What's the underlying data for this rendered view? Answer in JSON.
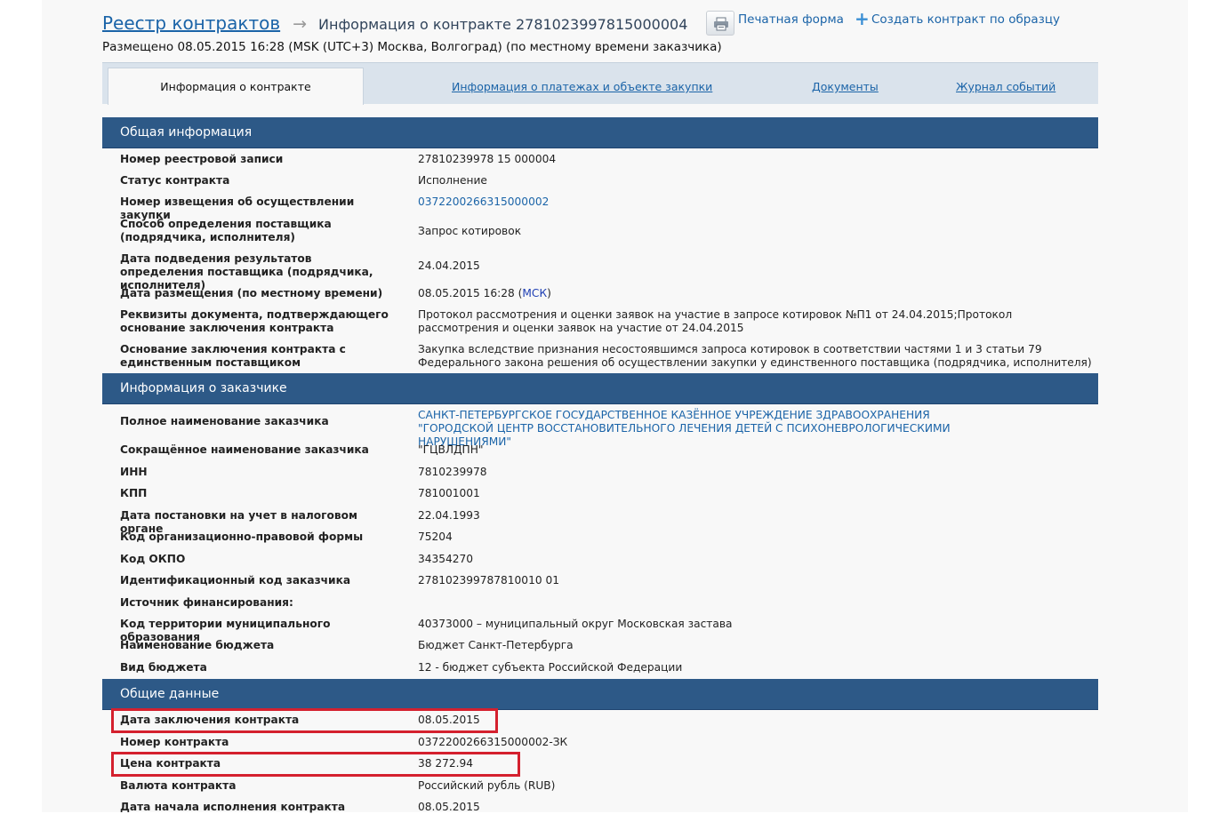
{
  "header": {
    "breadcrumb_link": "Реестр контрактов",
    "breadcrumb_arrow": "→",
    "current_page": "Информация о контракте 2781023997815000004",
    "posted": "Размещено 08.05.2015 16:28 (MSK (UTC+3) Москва, Волгоград) (по местному времени заказчика)",
    "print_label": "Печатная форма",
    "create_label": "Создать контракт по образцу",
    "create_icon": "+"
  },
  "tabs": [
    {
      "label": "Информация о контракте",
      "active": true
    },
    {
      "label": "Информация о платежах и объекте закупки",
      "active": false
    },
    {
      "label": "Документы",
      "active": false
    },
    {
      "label": "Журнал событий",
      "active": false
    }
  ],
  "sections": {
    "general": {
      "title": "Общая информация",
      "rows": [
        {
          "label": "Номер реестровой записи",
          "value": "27810239978 15 000004"
        },
        {
          "label": "Статус контракта",
          "value": "Исполнение"
        },
        {
          "label": "Номер извещения об осуществлении закупки",
          "value": "0372200266315000002"
        },
        {
          "label": "Способ определения поставщика (подрядчика, исполнителя)",
          "value": "Запрос котировок"
        },
        {
          "label": "Дата подведения результатов определения поставщика (подрядчика, исполнителя)",
          "value": "24.04.2015"
        },
        {
          "label": "Дата размещения (по местному времени)",
          "value": "08.05.2015 16:28",
          "tz_open": "(",
          "tz": "МСК",
          "tz_close": ")"
        },
        {
          "label": "Реквизиты документа, подтверждающего основание заключения контракта",
          "value": "Протокол рассмотрения и оценки заявок на участие в запросе котировок №П1 от 24.04.2015;Протокол рассмотрения и оценки заявок на участие от 24.04.2015"
        },
        {
          "label": "Основание заключения контракта с единственным поставщиком",
          "value": "Закупка вследствие признания несостоявшимся запроса котировок в соответствии частями 1 и 3 статьи 79 Федерального закона решения об осуществлении закупки у единственного поставщика (подрядчика, исполнителя)"
        }
      ]
    },
    "customer": {
      "title": "Информация о заказчике",
      "rows": [
        {
          "label": "Полное наименование заказчика",
          "value": "САНКТ-ПЕТЕРБУРГСКОЕ ГОСУДАРСТВЕННОЕ КАЗЁННОЕ УЧРЕЖДЕНИЕ ЗДРАВООХРАНЕНИЯ \"ГОРОДСКОЙ ЦЕНТР ВОССТАНОВИТЕЛЬНОГО ЛЕЧЕНИЯ ДЕТЕЙ С ПСИХОНЕВРОЛОГИЧЕСКИМИ НАРУШЕНИЯМИ\""
        },
        {
          "label": "Сокращённое наименование заказчика",
          "value": "\"ГЦВЛДПН\""
        },
        {
          "label": "ИНН",
          "value": "7810239978"
        },
        {
          "label": "КПП",
          "value": "781001001"
        },
        {
          "label": "Дата постановки на учет в налоговом органе",
          "value": "22.04.1993"
        },
        {
          "label": "Код организационно-правовой формы",
          "value": "75204"
        },
        {
          "label": "Код ОКПО",
          "value": "34354270"
        },
        {
          "label": "Идентификационный код заказчика",
          "value": "278102399787810010 01"
        },
        {
          "label": "Источник финансирования:",
          "value": ""
        },
        {
          "label": "Код территории муниципального образования",
          "value": "40373000 – муниципальный округ Московская застава"
        },
        {
          "label": "Наименование бюджета",
          "value": "Бюджет Санкт-Петербурга"
        },
        {
          "label": "Вид бюджета",
          "value": "12 - бюджет субъекта Российской Федерации"
        }
      ]
    },
    "common": {
      "title": "Общие данные",
      "rows": [
        {
          "label": "Дата заключения контракта",
          "value": "08.05.2015"
        },
        {
          "label": "Номер контракта",
          "value": "0372200266315000002-ЗК"
        },
        {
          "label": "Цена контракта",
          "value": "38 272.94"
        },
        {
          "label": "Валюта контракта",
          "value": "Российский рубль (RUB)"
        },
        {
          "label": "Дата начала исполнения контракта",
          "value": "08.05.2015"
        }
      ]
    }
  },
  "colors": {
    "section_header": "#2d5987",
    "link": "#1b64a8",
    "highlight": "#d4202e",
    "tab_bar": "#dae3ec"
  },
  "icons": [
    "arrow-right-icon",
    "printer-icon",
    "plus-icon"
  ]
}
